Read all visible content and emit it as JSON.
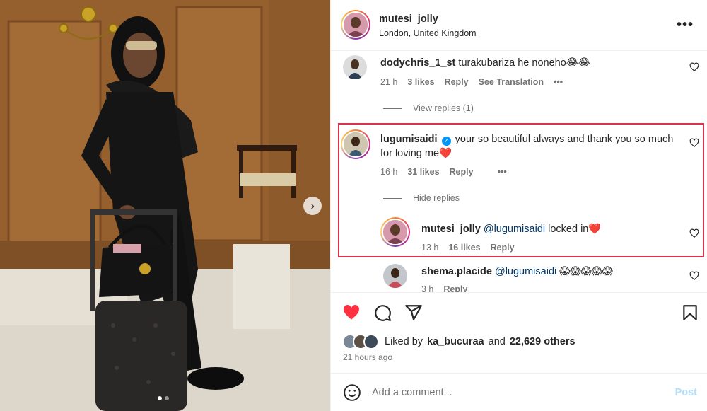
{
  "post": {
    "username": "mutesi_jolly",
    "location": "London, United Kingdom",
    "more_icon": "more-horizontal-icon",
    "carousel": {
      "next_icon": "chevron-right-icon",
      "slide_count": 2,
      "active_slide": 1
    }
  },
  "comments": [
    {
      "username": "dodychris_1_st",
      "text": "turakubariza he noneho😂😂",
      "time": "21 h",
      "likes": "3 likes",
      "reply_label": "Reply",
      "translate_label": "See Translation",
      "more": "•••",
      "view_replies": "View replies (1)"
    },
    {
      "username": "lugumisaidi",
      "verified": true,
      "text": "your so beautiful always and thank you so much",
      "text_line2": "for loving me❤️",
      "time": "16 h",
      "likes": "31 likes",
      "reply_label": "Reply",
      "more": "•••",
      "hide_replies": "Hide replies"
    }
  ],
  "replies": [
    {
      "username": "mutesi_jolly",
      "mention": "@lugumisaidi",
      "text": "locked in❤️",
      "time": "13 h",
      "likes": "16 likes",
      "reply_label": "Reply"
    },
    {
      "username": "shema.placide",
      "mention": "@lugumisaidi",
      "text": "😱😱😱😱😱",
      "time": "3 h",
      "reply_label": "Reply"
    }
  ],
  "actions": {
    "like_icon": "heart-filled-icon",
    "comment_icon": "comment-icon",
    "share_icon": "share-icon",
    "save_icon": "bookmark-icon",
    "liked_by_prefix": "Liked by",
    "liked_by_user": "ka_bucuraa",
    "liked_by_and": "and",
    "liked_by_others": "22,629 others",
    "time_ago": "21 hours ago"
  },
  "composer": {
    "emoji_icon": "smiley-icon",
    "placeholder": "Add a comment...",
    "post_label": "Post"
  },
  "colors": {
    "like_red": "#ff3040",
    "link_blue": "#00376b",
    "post_disabled": "#b2dffc",
    "highlight_red": "#d9334a",
    "verified_blue": "#0095f6"
  }
}
